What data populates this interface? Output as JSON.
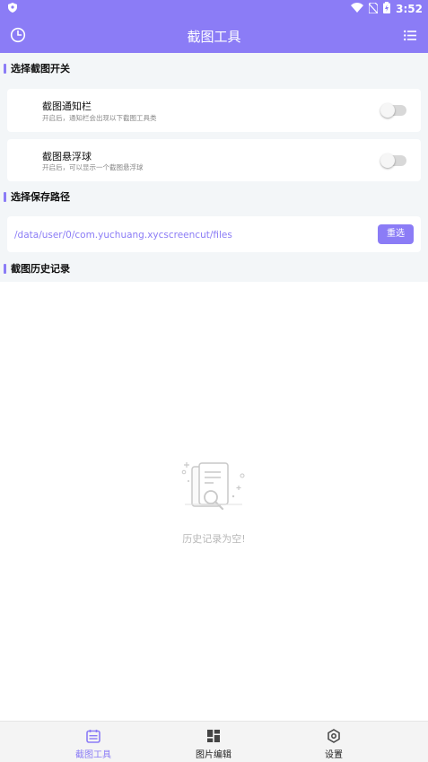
{
  "status_bar": {
    "time": "3:52"
  },
  "header": {
    "title": "截图工具"
  },
  "sections": {
    "switches_title": "选择截图开关",
    "path_title": "选择保存路径",
    "history_title": "截图历史记录"
  },
  "switches": [
    {
      "title": "截图通知栏",
      "subtitle": "开启后，通知栏会出现以下截图工具类",
      "enabled": false
    },
    {
      "title": "截图悬浮球",
      "subtitle": "开启后，可以显示一个截图悬浮球",
      "enabled": false
    }
  ],
  "save_path": {
    "path": "/data/user/0/com.yuchuang.xycscreencut/files",
    "reselect_label": "重选"
  },
  "empty_state": {
    "text": "历史记录为空!"
  },
  "bottom_nav": {
    "items": [
      {
        "label": "截图工具",
        "icon": "screenshot-tool-icon",
        "active": true
      },
      {
        "label": "图片编辑",
        "icon": "image-edit-icon",
        "active": false
      },
      {
        "label": "设置",
        "icon": "settings-icon",
        "active": false
      }
    ]
  },
  "colors": {
    "accent": "#8b7cf6",
    "background": "#f3f6f8"
  }
}
